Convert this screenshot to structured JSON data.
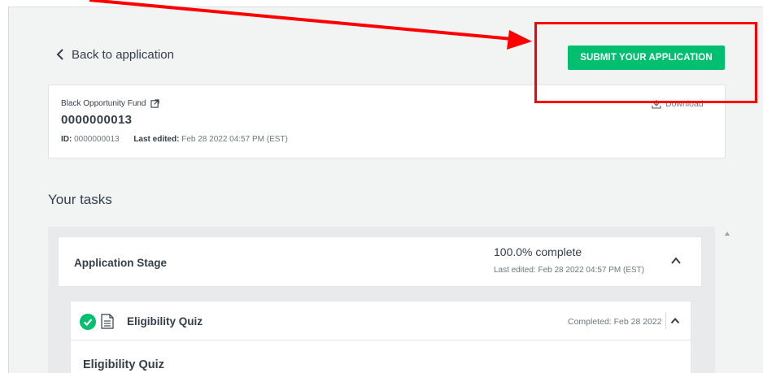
{
  "header": {
    "back_label": "Back to application",
    "submit_label": "SUBMIT YOUR APPLICATION"
  },
  "application": {
    "fund_name": "Black Opportunity Fund",
    "number": "0000000013",
    "id_label": "ID:",
    "id_value": "0000000013",
    "last_edited_label": "Last edited:",
    "last_edited_value": "Feb 28 2022 04:57 PM (EST)",
    "download_label": "Download"
  },
  "tasks": {
    "title": "Your tasks",
    "stage": {
      "label": "Application Stage",
      "percent_complete": "100.0% complete",
      "last_edited": "Last edited: Feb 28 2022 04:57 PM (EST)"
    },
    "items": [
      {
        "title": "Eligibility Quiz",
        "completed": "Completed: Feb 28 2022",
        "body_title": "Eligibility Quiz"
      }
    ]
  },
  "colors": {
    "accent_green": "#00bf6f",
    "annotation_red": "#ff0000",
    "text": "#333e48"
  },
  "icons": [
    "chevron-left-icon",
    "external-link-icon",
    "download-icon",
    "chevron-up-icon",
    "check-circle-icon",
    "document-icon"
  ]
}
